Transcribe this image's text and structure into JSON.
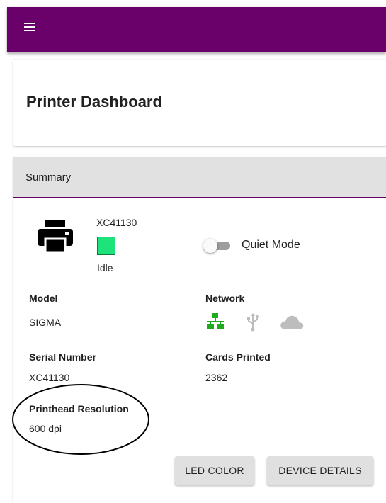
{
  "app": {
    "menu_icon": "hamburger-menu-icon",
    "colors": {
      "appbar": "#6a006a",
      "status_idle": "#1ee37a",
      "network_active": "#1faa1f",
      "network_inactive": "#bdbdbd"
    }
  },
  "page": {
    "title": "Printer Dashboard"
  },
  "summary": {
    "header": "Summary",
    "device": {
      "icon": "printer-icon",
      "name": "XC41130",
      "status": "Idle"
    },
    "quiet_mode": {
      "label": "Quiet Mode",
      "enabled": false
    },
    "fields": {
      "model_label": "Model",
      "model_value": "SIGMA",
      "network_label": "Network",
      "network_icons": [
        "ethernet-icon",
        "usb-icon",
        "cloud-icon"
      ],
      "serial_label": "Serial Number",
      "serial_value": "XC41130",
      "cards_label": "Cards Printed",
      "cards_value": "2362",
      "resolution_label": "Printhead Resolution",
      "resolution_value": "600 dpi"
    },
    "buttons": {
      "led_color": "LED COLOR",
      "device_details": "DEVICE DETAILS"
    }
  }
}
